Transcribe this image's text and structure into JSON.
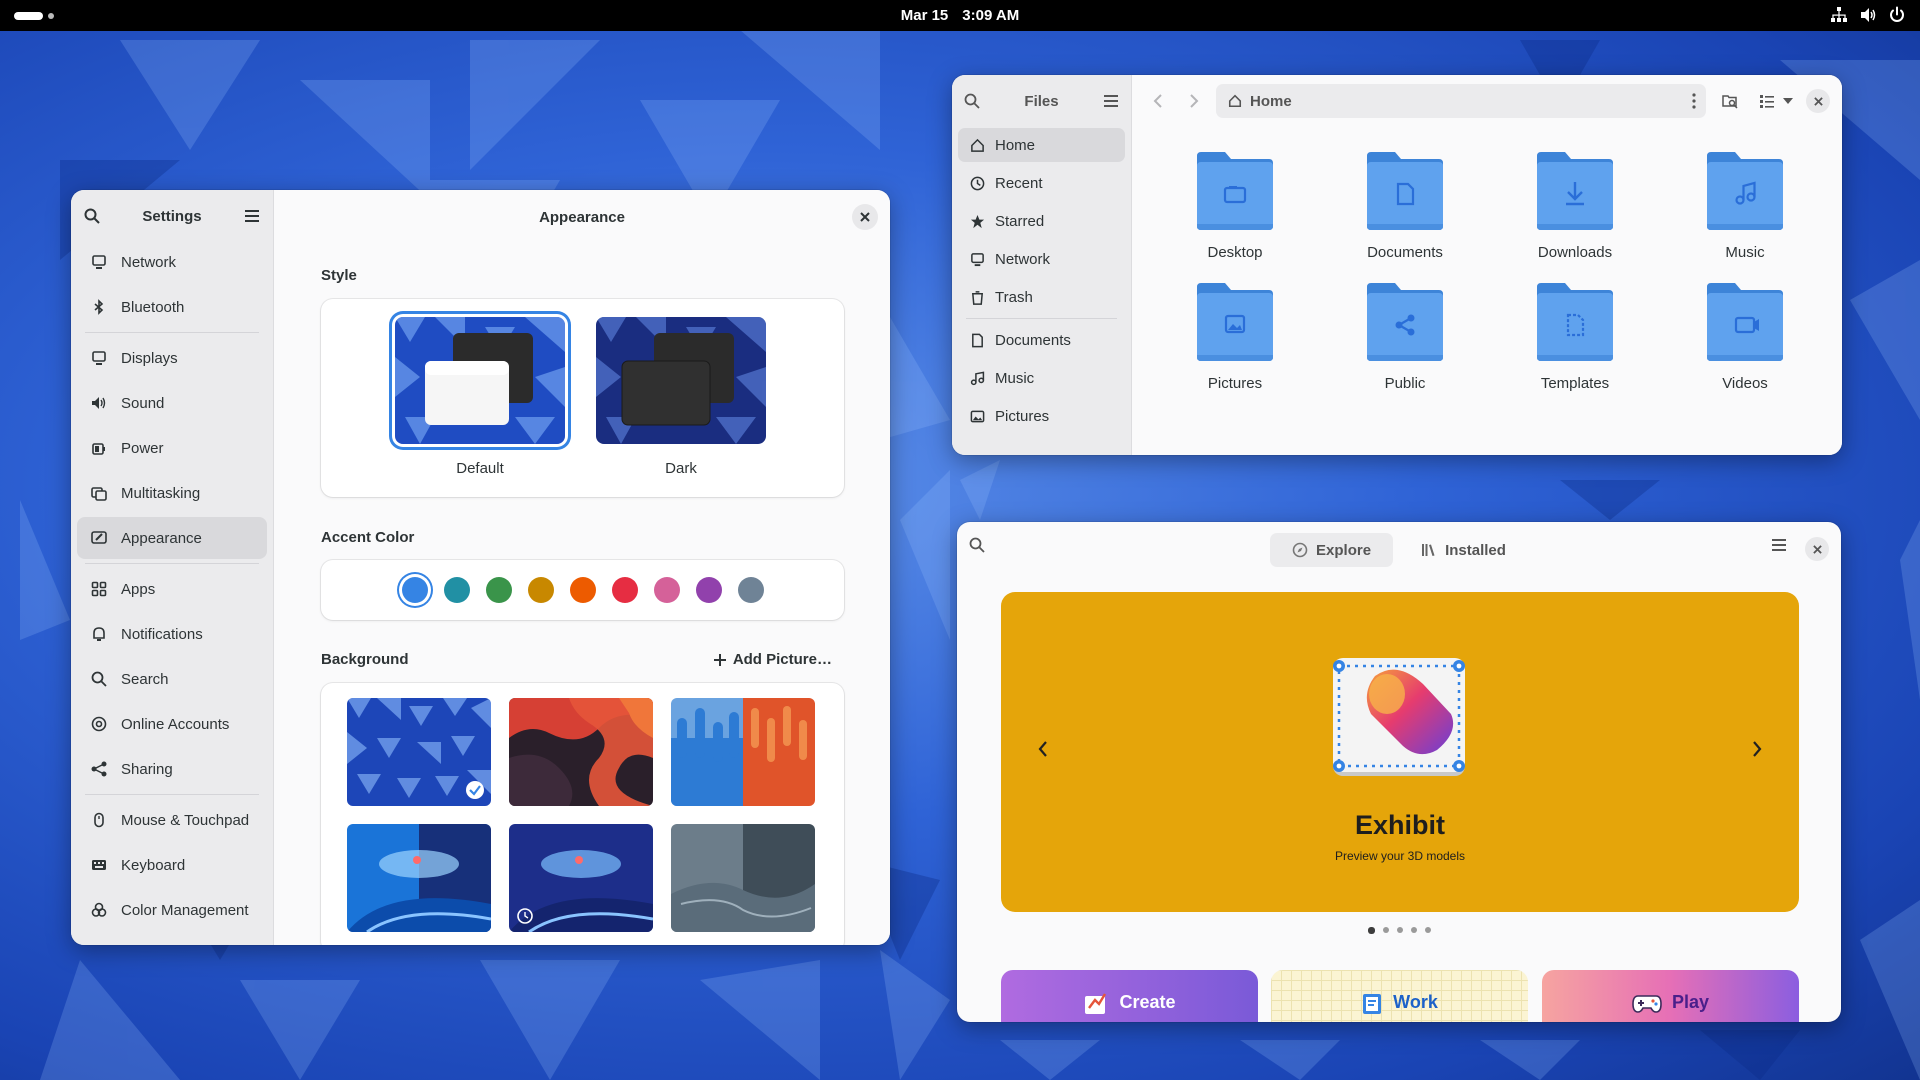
{
  "topbar": {
    "date": "Mar 15",
    "time": "3:09 AM"
  },
  "settings": {
    "sidebar_title": "Settings",
    "page_title": "Appearance",
    "nav": [
      {
        "label": "Network",
        "icon": "network-icon"
      },
      {
        "label": "Bluetooth",
        "icon": "bluetooth-icon"
      },
      {
        "label": "Displays",
        "icon": "display-icon"
      },
      {
        "label": "Sound",
        "icon": "sound-icon"
      },
      {
        "label": "Power",
        "icon": "power-icon"
      },
      {
        "label": "Multitasking",
        "icon": "multitasking-icon"
      },
      {
        "label": "Appearance",
        "icon": "appearance-icon"
      },
      {
        "label": "Apps",
        "icon": "apps-icon"
      },
      {
        "label": "Notifications",
        "icon": "bell-icon"
      },
      {
        "label": "Search",
        "icon": "search-icon"
      },
      {
        "label": "Online Accounts",
        "icon": "at-icon"
      },
      {
        "label": "Sharing",
        "icon": "share-icon"
      },
      {
        "label": "Mouse & Touchpad",
        "icon": "mouse-icon"
      },
      {
        "label": "Keyboard",
        "icon": "keyboard-icon"
      },
      {
        "label": "Color Management",
        "icon": "color-icon"
      }
    ],
    "style_label": "Style",
    "styles": [
      {
        "label": "Default"
      },
      {
        "label": "Dark"
      }
    ],
    "accent_label": "Accent Color",
    "accent_colors": [
      "#3584e4",
      "#2190a4",
      "#3a944a",
      "#c88800",
      "#ed5b00",
      "#e62d42",
      "#d56199",
      "#9141ac",
      "#6f8396"
    ],
    "background_label": "Background",
    "add_picture": "Add Picture…"
  },
  "files": {
    "title": "Files",
    "path": "Home",
    "sidebar": [
      {
        "label": "Home",
        "icon": "home-icon"
      },
      {
        "label": "Recent",
        "icon": "clock-icon"
      },
      {
        "label": "Starred",
        "icon": "star-icon"
      },
      {
        "label": "Network",
        "icon": "network-icon"
      },
      {
        "label": "Trash",
        "icon": "trash-icon"
      },
      {
        "label": "Documents",
        "icon": "document-icon"
      },
      {
        "label": "Music",
        "icon": "music-icon"
      },
      {
        "label": "Pictures",
        "icon": "picture-icon"
      }
    ],
    "folders": [
      {
        "name": "Desktop",
        "icon": "desktop-icon"
      },
      {
        "name": "Documents",
        "icon": "document-icon"
      },
      {
        "name": "Downloads",
        "icon": "download-icon"
      },
      {
        "name": "Music",
        "icon": "music-icon"
      },
      {
        "name": "Pictures",
        "icon": "picture-icon"
      },
      {
        "name": "Public",
        "icon": "share-icon"
      },
      {
        "name": "Templates",
        "icon": "template-icon"
      },
      {
        "name": "Videos",
        "icon": "video-icon"
      }
    ]
  },
  "software": {
    "tabs": [
      {
        "label": "Explore",
        "icon": "compass-icon"
      },
      {
        "label": "Installed",
        "icon": "library-icon"
      }
    ],
    "featured_app": "Exhibit",
    "featured_desc": "Preview your 3D models",
    "categories": [
      {
        "label": "Create"
      },
      {
        "label": "Work"
      },
      {
        "label": "Play"
      }
    ]
  }
}
